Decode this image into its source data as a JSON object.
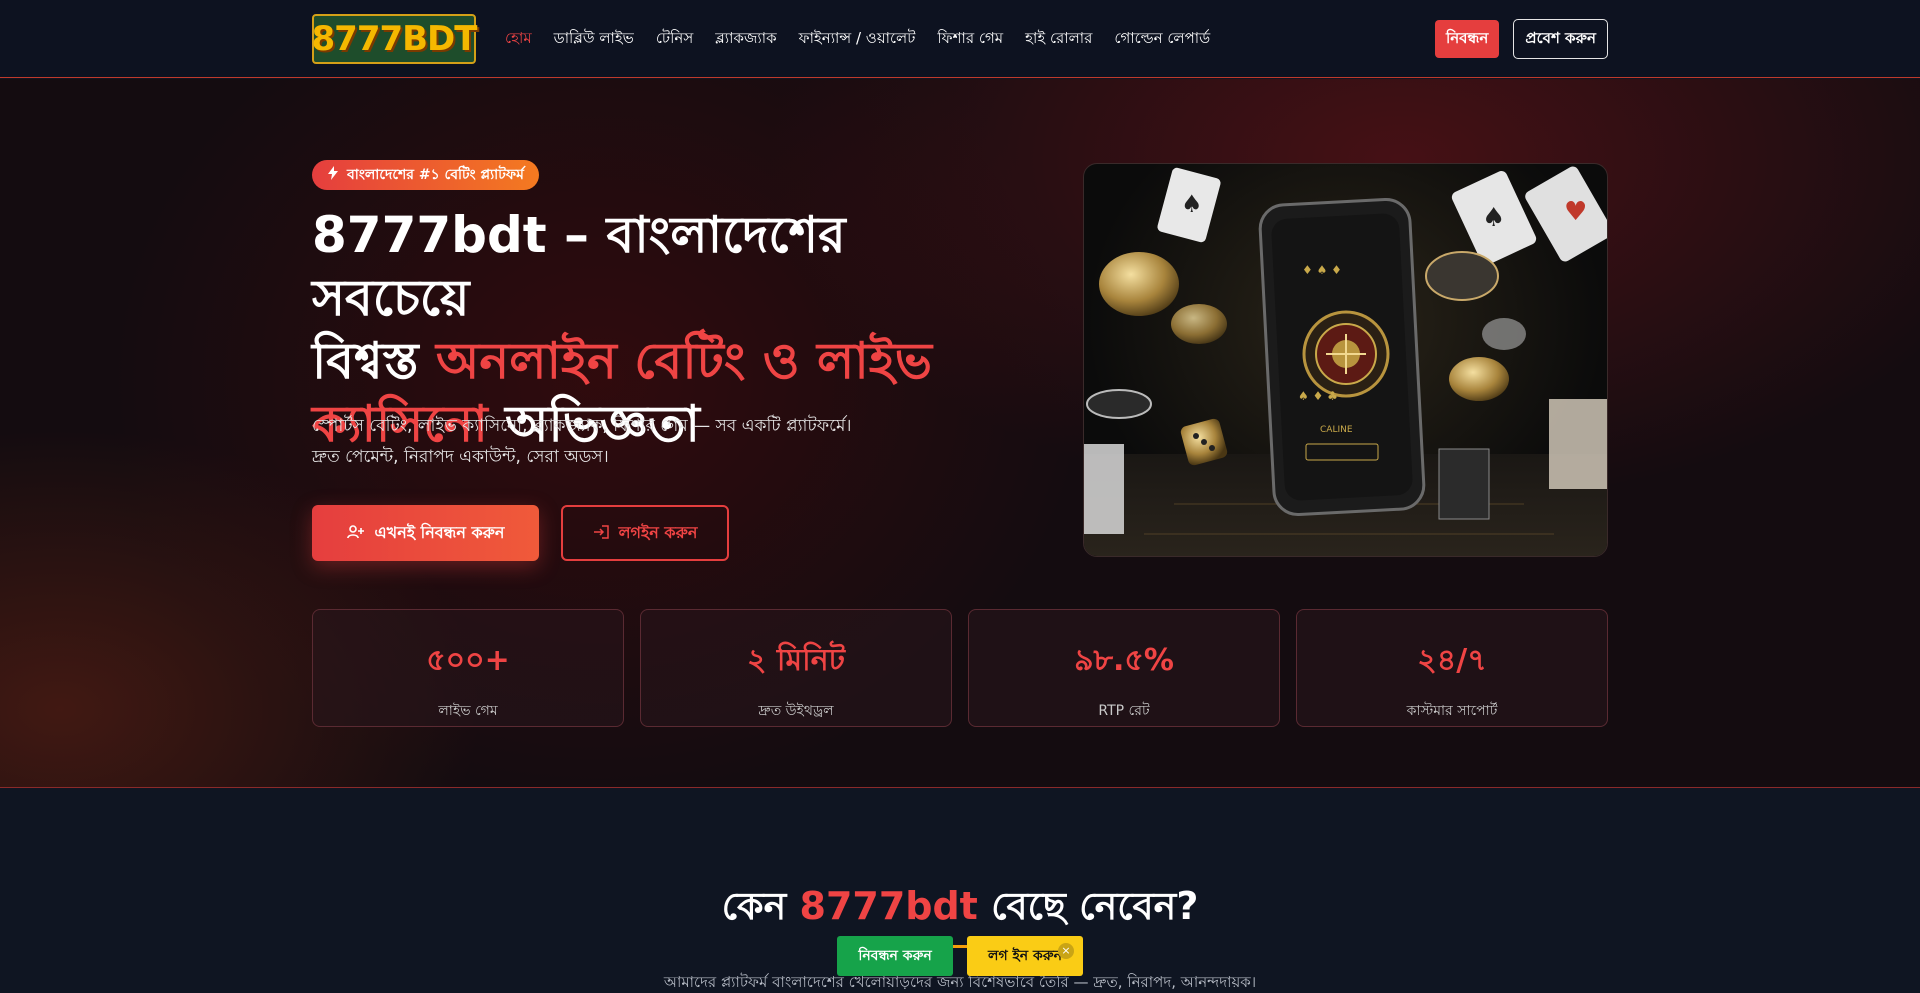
{
  "header": {
    "logo_text": "8777BDT",
    "nav": [
      {
        "label": "হোম",
        "active": true
      },
      {
        "label": "ডাব্লিউ লাইভ"
      },
      {
        "label": "টেনিস"
      },
      {
        "label": "ব্ল্যাকজ্যাক"
      },
      {
        "label": "ফাইন্যান্স / ওয়ালেট"
      },
      {
        "label": "ফিশার গেম"
      },
      {
        "label": "হাই রোলার"
      },
      {
        "label": "গোল্ডেন লেপার্ড"
      }
    ],
    "register_label": "নিবন্ধন",
    "login_label": "প্রবেশ করুন"
  },
  "hero": {
    "badge": "বাংলাদেশের #১ বেটিং প্ল্যাটফর্ম",
    "title_line1": "8777bdt – বাংলাদেশের সবচেয়ে",
    "title_part2_plain": "বিশ্বস্ত ",
    "title_part2_accent": "অনলাইন বেটিং ও লাইভ",
    "title_part3_accent": "ক্যাসিনো",
    "title_part3_plain": " অভিজ্ঞতা",
    "desc_line1": "স্পোর্টস বেটিং, লাইভ ক্যাসিনো, ব্ল্যাকজ্যাক, ফিশার গেম — সব একটি প্ল্যাটফর্মে।",
    "desc_line2": "দ্রুত পেমেন্ট, নিরাপদ একাউন্ট, সেরা অডস।",
    "primary_cta": "এখনই নিবন্ধন করুন",
    "secondary_cta": "লগইন করুন"
  },
  "stats": [
    {
      "value": "৫০০+",
      "label": "লাইভ গেম"
    },
    {
      "value": "২ মিনিট",
      "label": "দ্রুত উইথড্রল"
    },
    {
      "value": "৯৮.৫%",
      "label": "RTP রেট"
    },
    {
      "value": "২৪/৭",
      "label": "কাস্টমার সাপোর্ট"
    }
  ],
  "why": {
    "title_prefix": "কেন ",
    "title_accent": "8777bdt",
    "title_suffix": " বেছে নেবেন?",
    "subtitle": "আমাদের প্ল্যাটফর্ম বাংলাদেশের খেলোয়াড়দের জন্য বিশেষভাবে তৈরি — দ্রুত, নিরাপদ, আনন্দদায়ক।"
  },
  "floating": {
    "register_label": "নিবন্ধন করুন",
    "login_label": "লগ ইন করুন",
    "close_glyph": "×"
  },
  "colors": {
    "accent": "#ef4444",
    "header_bg": "#0d1220",
    "floating_register": "#16a34a",
    "floating_login": "#facc15"
  }
}
